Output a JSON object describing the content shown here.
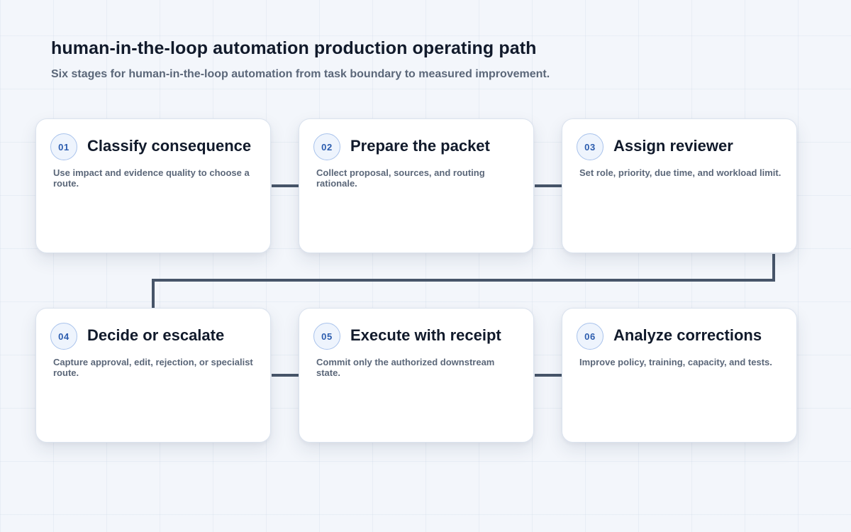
{
  "title": "human-in-the-loop automation production operating path",
  "subtitle": "Six stages for human-in-the-loop automation from task boundary to measured improvement.",
  "colors": {
    "background": "#f3f6fb",
    "card": "#ffffff",
    "connector": "#475569",
    "badge_border": "#a9c3ec",
    "badge_text": "#2b5cae",
    "title_text": "#111a2b",
    "muted_text": "#5b6779"
  },
  "stages": [
    {
      "number": "01",
      "title": "Classify consequence",
      "description": "Use impact and evidence quality to choose a route."
    },
    {
      "number": "02",
      "title": "Prepare the packet",
      "description": "Collect proposal, sources, and routing rationale."
    },
    {
      "number": "03",
      "title": "Assign reviewer",
      "description": "Set role, priority, due time, and workload limit."
    },
    {
      "number": "04",
      "title": "Decide or escalate",
      "description": "Capture approval, edit, rejection, or specialist route."
    },
    {
      "number": "05",
      "title": "Execute with receipt",
      "description": "Commit only the authorized downstream state."
    },
    {
      "number": "06",
      "title": "Analyze corrections",
      "description": "Improve policy, training, capacity, and tests."
    }
  ]
}
